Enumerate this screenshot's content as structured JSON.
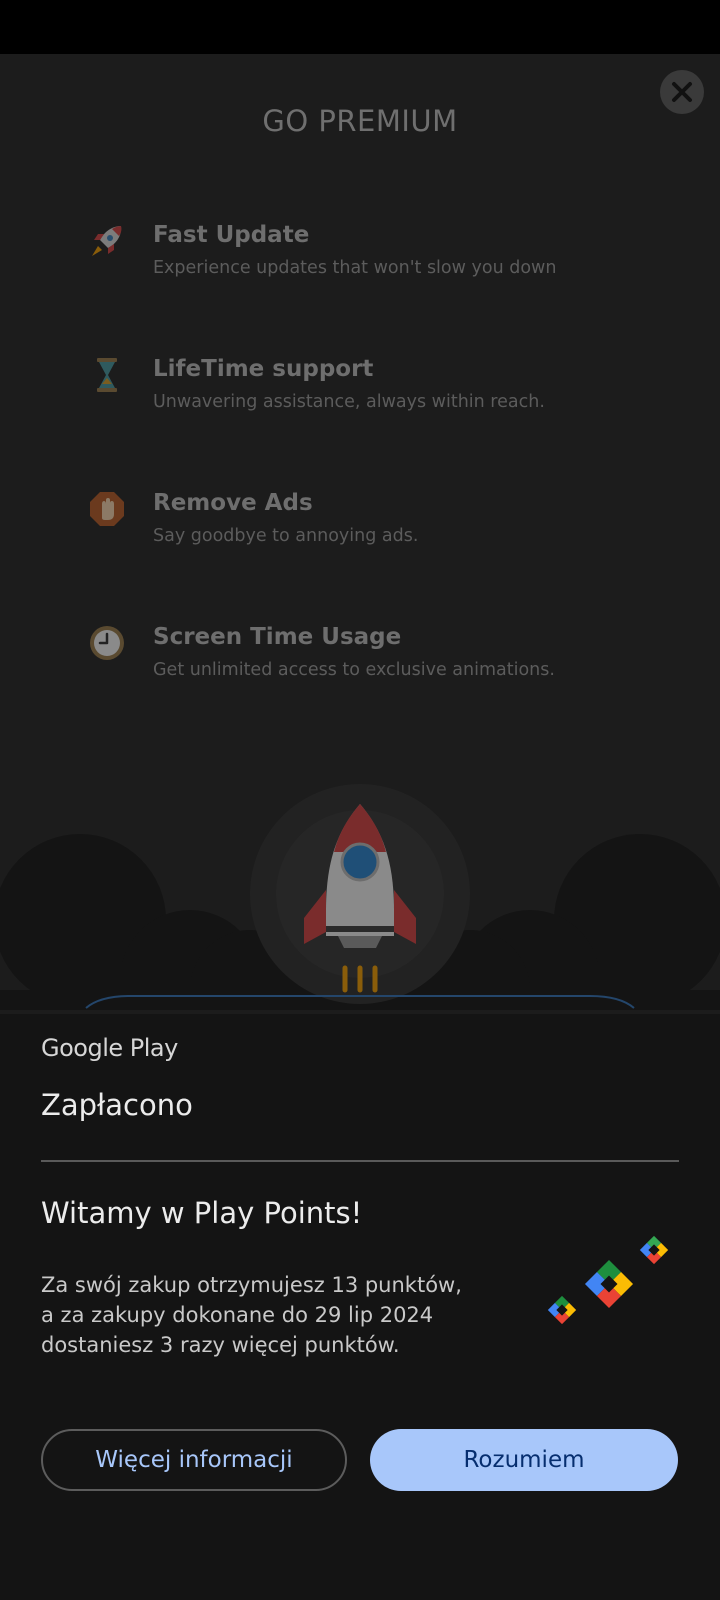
{
  "premium": {
    "title": "GO PREMIUM",
    "close_icon": "close-icon",
    "features": [
      {
        "icon": "rocket-icon",
        "name": "Fast Update",
        "desc": "Experience updates that won't slow you down"
      },
      {
        "icon": "hourglass-icon",
        "name": "LifeTime support",
        "desc": "Unwavering assistance, always within reach."
      },
      {
        "icon": "stop-hand-icon",
        "name": "Remove Ads",
        "desc": "Say goodbye to annoying ads."
      },
      {
        "icon": "clock-icon",
        "name": "Screen Time Usage",
        "desc": "Get unlimited access to exclusive animations."
      }
    ]
  },
  "sheet": {
    "brand": "Google Play",
    "status": "Zapłacono",
    "welcome_title": "Witamy w Play Points!",
    "message_lines": [
      "Za swój zakup otrzymujesz 13 punktów,",
      "a za zakupy dokonane do 29 lip 2024",
      "dostaniesz 3 razy więcej punktów."
    ],
    "more_info_label": "Więcej informacji",
    "ok_label": "Rozumiem"
  },
  "colors": {
    "accent": "#a8c7fa",
    "accent_text": "#062e6f",
    "sheet_bg": "#141414",
    "overlay_bg": "#1c1c1c"
  }
}
